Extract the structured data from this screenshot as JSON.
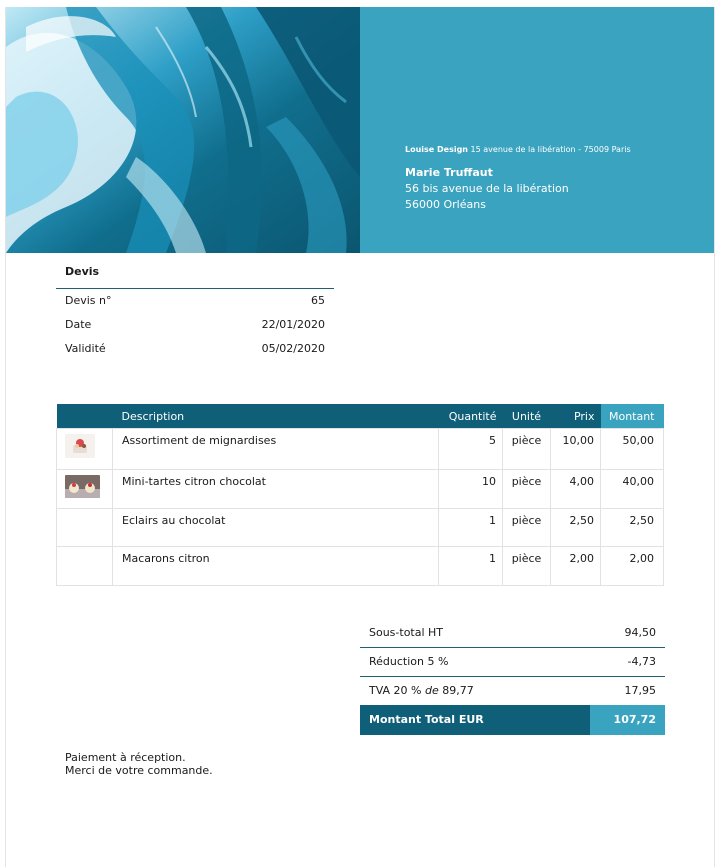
{
  "header": {
    "sender_company": "Louise Design",
    "sender_address": "15 avenue de la libération - 75009 Paris",
    "recipient_name": "Marie Truffaut",
    "recipient_line1": "56 bis avenue de la libération",
    "recipient_line2": "56000 Orléans"
  },
  "quote": {
    "title": "Devis",
    "number_label": "Devis n°",
    "number_value": "65",
    "date_label": "Date",
    "date_value": "22/01/2020",
    "validity_label": "Validité",
    "validity_value": "05/02/2020"
  },
  "items": {
    "headers": {
      "description": "Description",
      "quantity": "Quantité",
      "unit": "Unité",
      "price": "Prix",
      "amount": "Montant"
    },
    "rows": [
      {
        "description": "Assortiment de mignardises",
        "quantity": "5",
        "unit": "pièce",
        "price": "10,00",
        "amount": "50,00"
      },
      {
        "description": "Mini-tartes citron chocolat",
        "quantity": "10",
        "unit": "pièce",
        "price": "4,00",
        "amount": "40,00"
      },
      {
        "description": "Eclairs au chocolat",
        "quantity": "1",
        "unit": "pièce",
        "price": "2,50",
        "amount": "2,50"
      },
      {
        "description": "Macarons citron",
        "quantity": "1",
        "unit": "pièce",
        "price": "2,00",
        "amount": "2,00"
      }
    ]
  },
  "totals": {
    "subtotal_label": "Sous-total HT",
    "subtotal_value": "94,50",
    "discount_label": "Réduction 5 %",
    "discount_value": "-4,73",
    "vat_label_prefix": "TVA 20 %",
    "vat_label_de": "de",
    "vat_label_base": "89,77",
    "vat_value": "17,95",
    "total_label": "Montant Total EUR",
    "total_value": "107,72"
  },
  "footer": {
    "line1": "Paiement à réception.",
    "line2": "Merci de votre commande."
  },
  "colors": {
    "dark_teal": "#0f5f79",
    "light_teal": "#3aa3bf"
  }
}
